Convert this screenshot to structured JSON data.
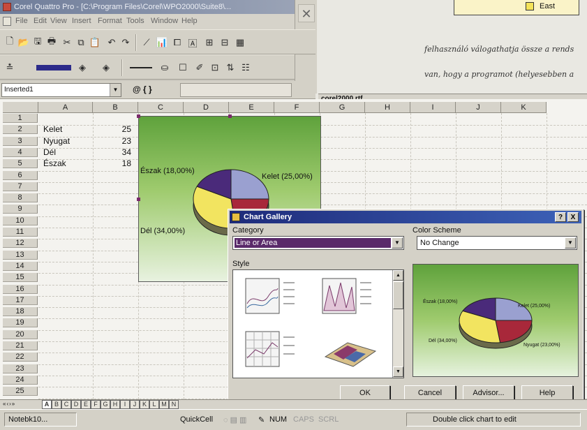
{
  "app": {
    "title": "Corel Quattro Pro - [C:\\Program Files\\Corel\\WPO2000\\Suite8\\...",
    "menu": [
      "File",
      "Edit",
      "View",
      "Insert",
      "Format",
      "Tools",
      "Window",
      "Help"
    ]
  },
  "formula": {
    "cell_name": "Inserted1",
    "at_label": "@ { }"
  },
  "sheet": {
    "columns": [
      "A",
      "B",
      "C",
      "D",
      "E",
      "F",
      "G",
      "H",
      "I",
      "J",
      "K"
    ],
    "rows": [
      "1",
      "2",
      "3",
      "4",
      "5",
      "6",
      "7",
      "8",
      "9",
      "10",
      "11",
      "12",
      "13",
      "14",
      "15",
      "16",
      "17",
      "18",
      "19",
      "20",
      "21",
      "22",
      "23",
      "24",
      "25"
    ],
    "data": [
      {
        "label": "Kelet",
        "value": "25"
      },
      {
        "label": "Nyugat",
        "value": "23"
      },
      {
        "label": "Dél",
        "value": "34"
      },
      {
        "label": "Észak",
        "value": "18"
      }
    ],
    "tabs": [
      "A",
      "B",
      "C",
      "D",
      "E",
      "F",
      "G",
      "H",
      "I",
      "J",
      "K",
      "L",
      "M",
      "N"
    ]
  },
  "sheet_chart": {
    "labels": {
      "north": "Észak (18,00%)",
      "east": "Kelet (25,00%)",
      "south": "Dél (34,00%)"
    },
    "colors": {
      "east": "#9aa0d0",
      "west": "#a8283a",
      "south": "#f2e460",
      "north": "#4a2a7a"
    }
  },
  "chart_data": {
    "type": "pie",
    "categories": [
      "Kelet",
      "Nyugat",
      "Dél",
      "Észak"
    ],
    "values": [
      25,
      23,
      34,
      18
    ]
  },
  "document": {
    "filename": "corel2000.rtf",
    "line1": "felhasználó válogathatja össze a rends",
    "line2": "van, hogy a programot (helyesebben a",
    "legend_label": "East"
  },
  "dialog": {
    "title": "Chart Gallery",
    "help_btn": "?",
    "close_btn": "X",
    "category_label": "Category",
    "category_value": "Line or Area",
    "scheme_label": "Color Scheme",
    "scheme_value": "No Change",
    "style_label": "Style",
    "preview_labels": {
      "north": "Észak (18,00%)",
      "east": "Kelet (25,00%)",
      "south": "Dél (34,00%)",
      "west": "Nyugat (23,00%)"
    },
    "buttons": {
      "ok": "OK",
      "cancel": "Cancel",
      "advisor": "Advisor...",
      "help": "Help"
    }
  },
  "status": {
    "notebook": "Notebk10...",
    "quickcell": "QuickCell",
    "num": "NUM",
    "caps": "CAPS",
    "scrl": "SCRL",
    "message": "Double click chart to edit"
  }
}
